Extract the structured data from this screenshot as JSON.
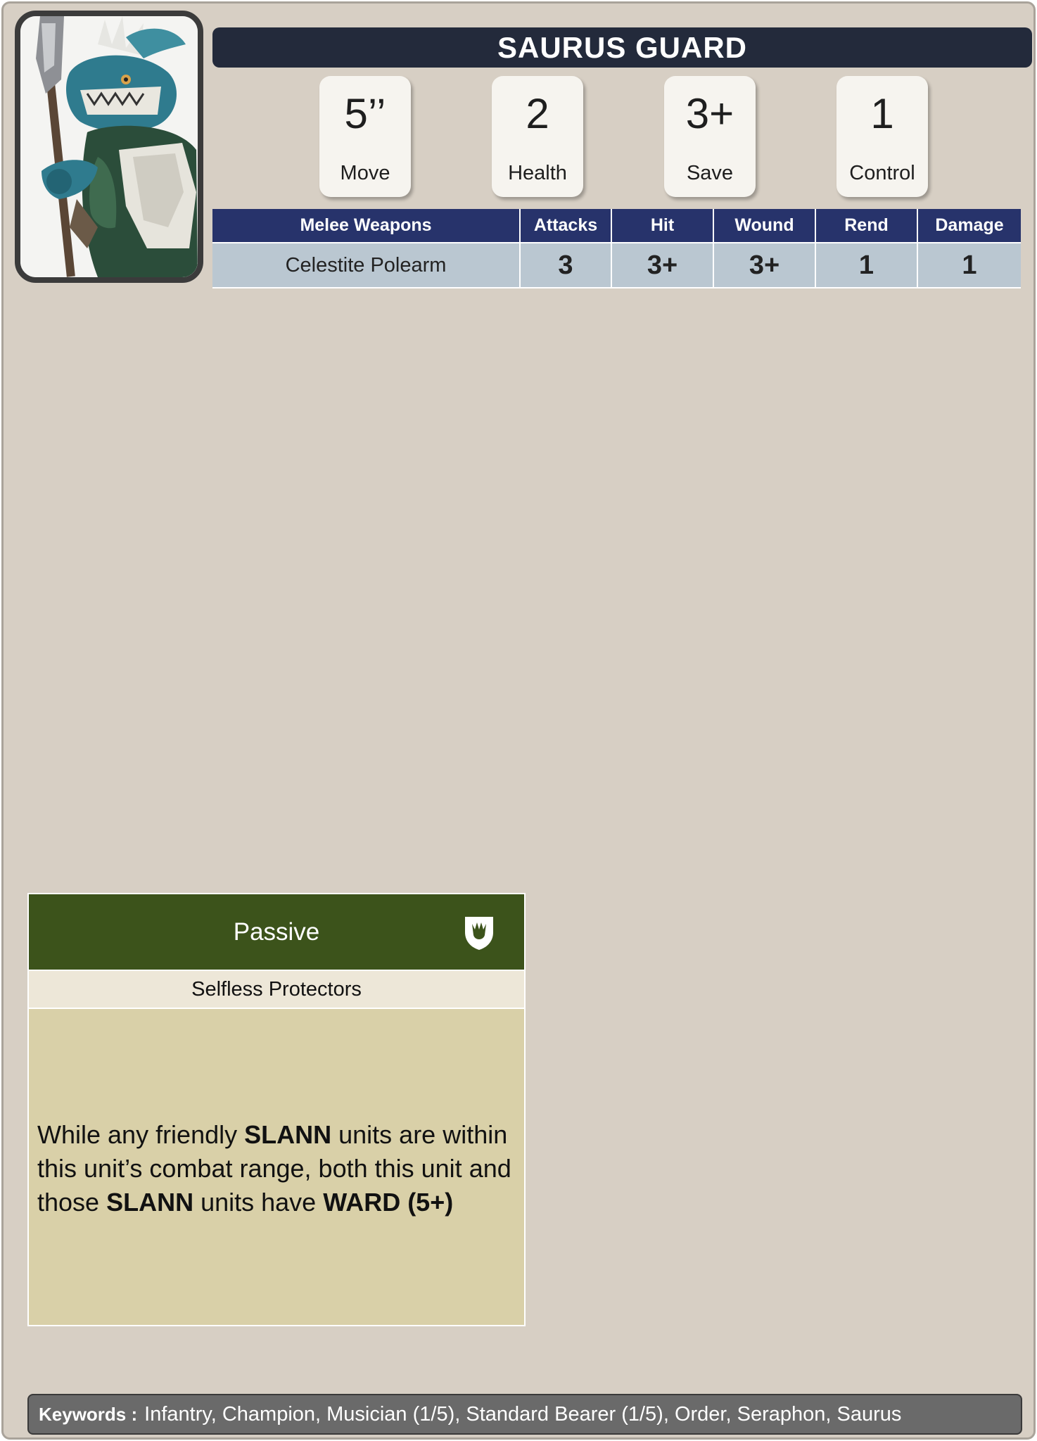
{
  "unit": {
    "name": "SAURUS GUARD"
  },
  "stats": [
    {
      "value": "5’’",
      "label": "Move"
    },
    {
      "value": "2",
      "label": "Health"
    },
    {
      "value": "3+",
      "label": "Save"
    },
    {
      "value": "1",
      "label": "Control"
    }
  ],
  "melee_table": {
    "headers": [
      "Melee Weapons",
      "Attacks",
      "Hit",
      "Wound",
      "Rend",
      "Damage"
    ],
    "rows": [
      [
        "Celestite Polearm",
        "3",
        "3+",
        "3+",
        "1",
        "1"
      ]
    ]
  },
  "ability": {
    "type": "Passive",
    "icon": "shield-icon",
    "name": "Selfless Protectors",
    "text_1": "While any friendly ",
    "bold_1": "SLANN",
    "text_2": " units are within this unit’s combat range, both this unit and those ",
    "bold_2": "SLANN",
    "text_3": " units have ",
    "bold_3": "WARD (5+)"
  },
  "keywords": {
    "label": "Keywords :",
    "value": "Infantry, Champion, Musician (1/5), Standard Bearer (1/5), Order, Seraphon, Saurus"
  },
  "colors": {
    "card_bg": "#d7cfc4",
    "title_bar": "#232a3b",
    "table_header": "#27336b",
    "table_row": "#bac7d1",
    "ability_header": "#3c531b",
    "ability_body": "#d9d0a8",
    "keywords_bar": "#6a6a6a"
  }
}
